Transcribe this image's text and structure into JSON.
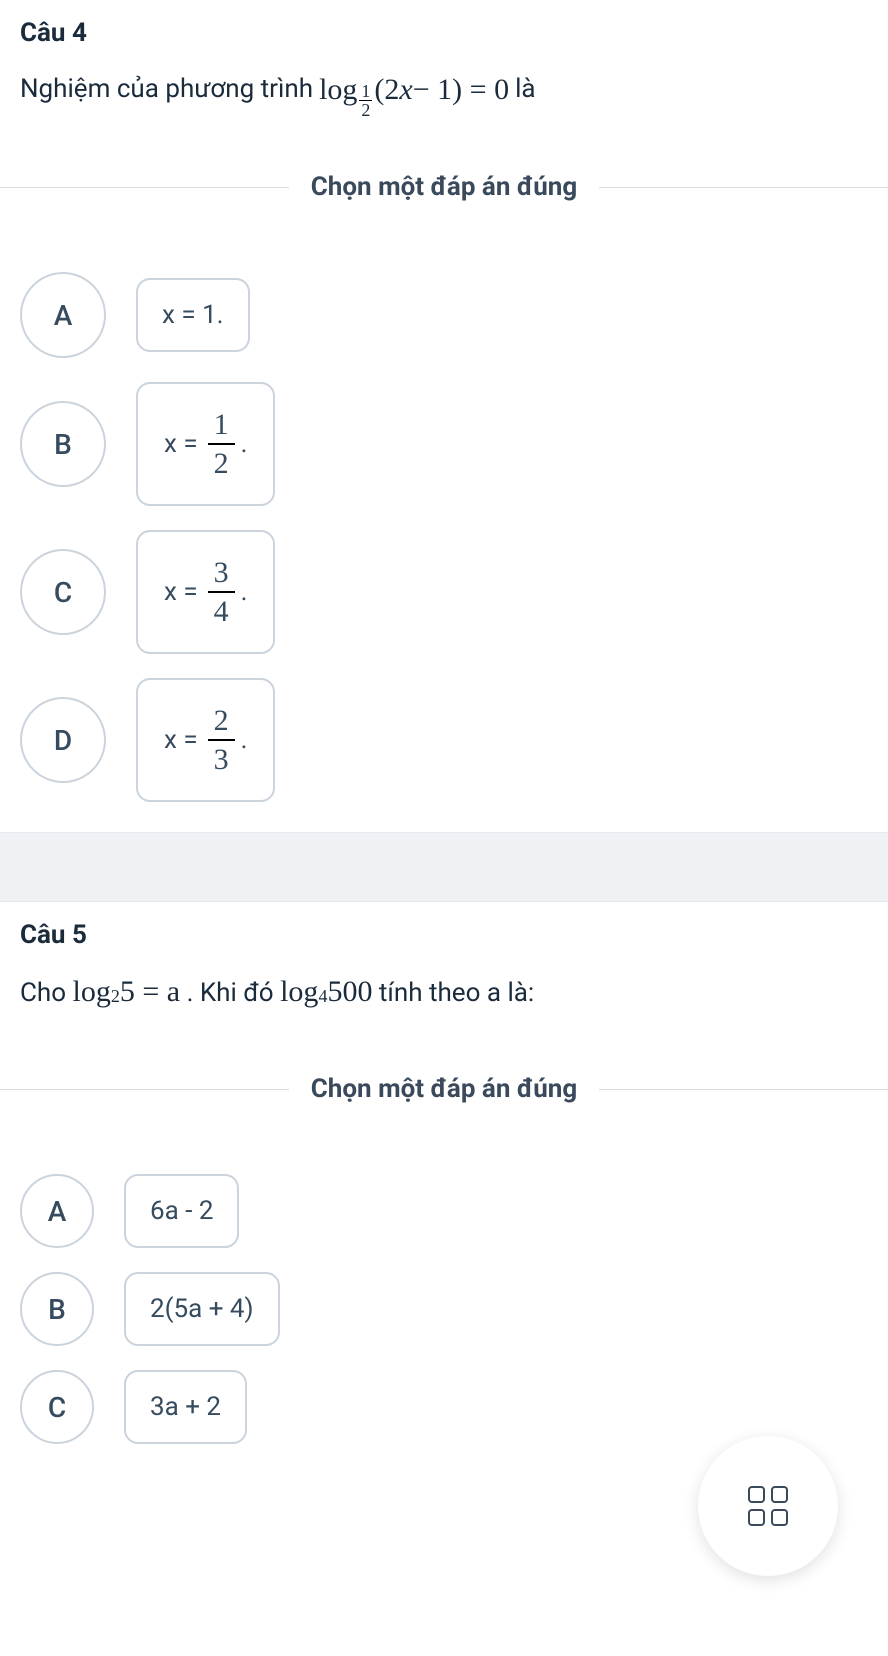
{
  "q4": {
    "title": "Câu 4",
    "text_before": "Nghiệm của phương trình",
    "equation": {
      "log_label": "log",
      "sub_top": "1",
      "sub_bot": "2",
      "arg": "(2",
      "var": "x",
      "arg2": " − 1) = 0"
    },
    "text_after": "là",
    "instruction": "Chọn một đáp án đúng",
    "options": {
      "a": {
        "letter": "A",
        "text": "x = 1."
      },
      "b": {
        "letter": "B",
        "prefix": "x =",
        "num": "1",
        "den": "2",
        "suffix": "."
      },
      "c": {
        "letter": "C",
        "prefix": "x =",
        "num": "3",
        "den": "4",
        "suffix": "."
      },
      "d": {
        "letter": "D",
        "prefix": "x =",
        "num": "2",
        "den": "3",
        "suffix": "."
      }
    }
  },
  "q5": {
    "title": "Câu 5",
    "text_cho": "Cho",
    "eq1": {
      "log": "log",
      "sub": "2",
      "rest": " 5 = a"
    },
    "text_mid": ". Khi đó",
    "eq2": {
      "log": "log",
      "sub": "4",
      "rest": " 500"
    },
    "text_after": " tính theo a là:",
    "instruction": "Chọn một đáp án đúng",
    "options": {
      "a": {
        "letter": "A",
        "text": "6a - 2"
      },
      "b": {
        "letter": "B",
        "text": "2(5a + 4)"
      },
      "c": {
        "letter": "C",
        "text": "3a + 2"
      }
    }
  }
}
